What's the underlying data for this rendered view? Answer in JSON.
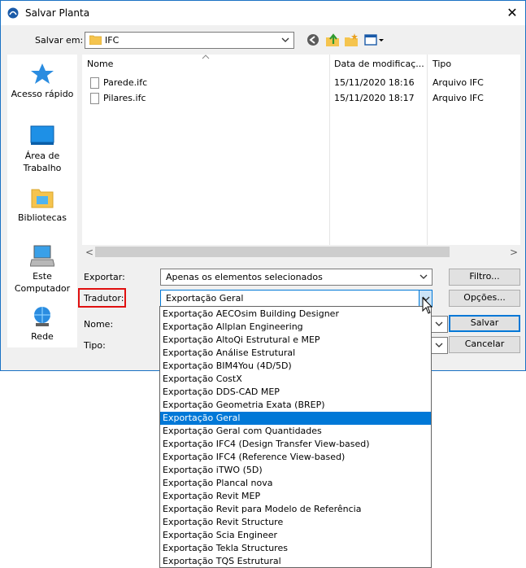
{
  "window": {
    "title": "Salvar Planta",
    "close": "✕"
  },
  "savein": {
    "label": "Salvar em:",
    "value": "IFC"
  },
  "places": [
    {
      "label1": "Acesso rápido",
      "label2": ""
    },
    {
      "label1": "Área de",
      "label2": "Trabalho"
    },
    {
      "label1": "Bibliotecas",
      "label2": ""
    },
    {
      "label1": "Este",
      "label2": "Computador"
    },
    {
      "label1": "Rede",
      "label2": ""
    }
  ],
  "columns": {
    "name": "Nome",
    "date": "Data de modificaç...",
    "type": "Tipo"
  },
  "files": [
    {
      "name": "Parede.ifc",
      "date": "15/11/2020 18:16",
      "type": "Arquivo IFC"
    },
    {
      "name": "Pilares.ifc",
      "date": "15/11/2020 18:17",
      "type": "Arquivo IFC"
    }
  ],
  "scroll": {
    "left": "<",
    "right": ">"
  },
  "form": {
    "exportar_label": "Exportar:",
    "exportar_value": "Apenas os elementos selecionados",
    "tradutor_label": "Tradutor:",
    "tradutor_value": "Exportação Geral",
    "nome_label": "Nome:",
    "tipo_label": "Tipo:"
  },
  "buttons": {
    "filtro": "Filtro...",
    "opcoes": "Opções...",
    "salvar": "Salvar",
    "cancelar": "Cancelar"
  },
  "translator_options": [
    "Exportação AECOsim Building Designer",
    "Exportação Allplan Engineering",
    "Exportação AltoQi Estrutural e MEP",
    "Exportação Análise Estrutural",
    "Exportação BIM4You (4D/5D)",
    "Exportação CostX",
    "Exportação DDS-CAD MEP",
    "Exportação Geometria Exata (BREP)",
    "Exportação Geral",
    "Exportação Geral com Quantidades",
    "Exportação IFC4 (Design Transfer View-based)",
    "Exportação IFC4 (Reference View-based)",
    "Exportação iTWO (5D)",
    "Exportação Plancal nova",
    "Exportação Revit MEP",
    "Exportação Revit para Modelo de Referência",
    "Exportação Revit Structure",
    "Exportação Scia Engineer",
    "Exportação Tekla Structures",
    "Exportação TQS Estrutural"
  ],
  "selected_option_index": 8,
  "colors": {
    "accent": "#0078d7",
    "highlight": "#e01010"
  }
}
